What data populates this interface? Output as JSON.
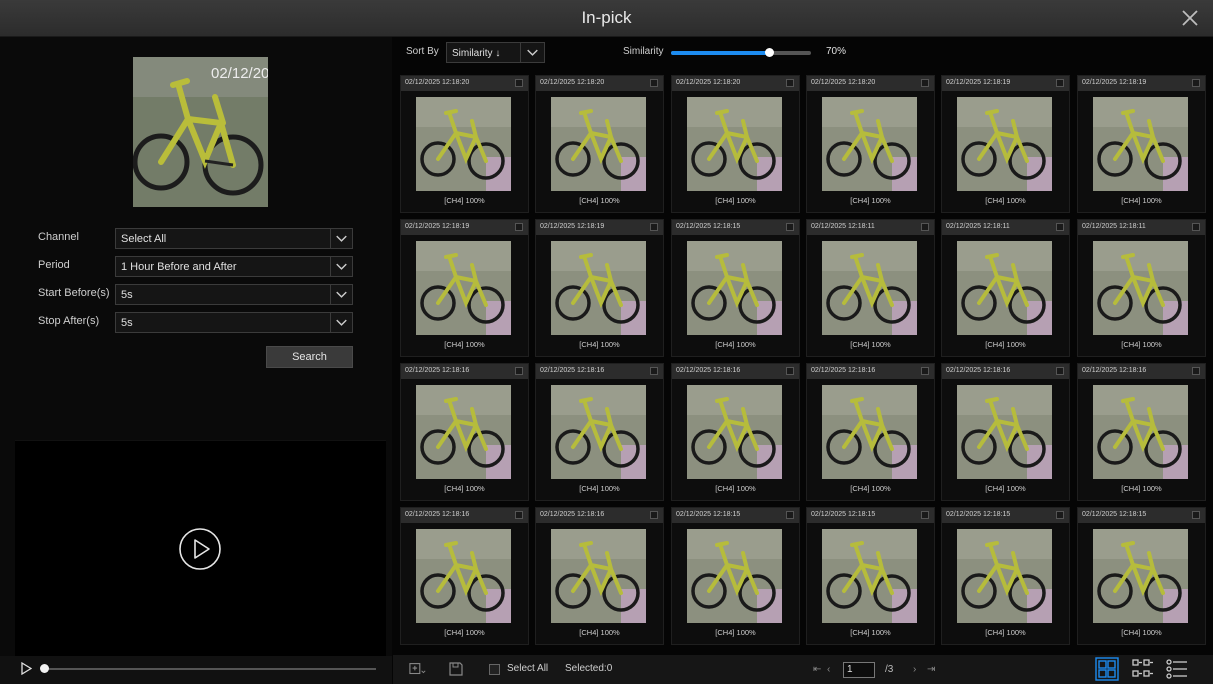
{
  "window": {
    "title": "In-pick"
  },
  "query": {
    "timestamp_overlay": "02/12/20"
  },
  "form": {
    "channel": {
      "label": "Channel",
      "value": "Select All"
    },
    "period": {
      "label": "Period",
      "value": "1 Hour Before and After"
    },
    "start_before": {
      "label": "Start Before(s)",
      "value": "5s"
    },
    "stop_after": {
      "label": "Stop After(s)",
      "value": "5s"
    },
    "search_label": "Search"
  },
  "player": {
    "progress": 0
  },
  "toolbar": {
    "sort_label": "Sort By",
    "sort_value": "Similarity ↓",
    "similarity_label": "Similarity",
    "similarity_value": "70%",
    "similarity_fraction": 0.7
  },
  "results": [
    {
      "time": "02/12/2025 12:18:20",
      "caption": "[CH4] 100%"
    },
    {
      "time": "02/12/2025 12:18:20",
      "caption": "[CH4] 100%"
    },
    {
      "time": "02/12/2025 12:18:20",
      "caption": "[CH4] 100%"
    },
    {
      "time": "02/12/2025 12:18:20",
      "caption": "[CH4] 100%"
    },
    {
      "time": "02/12/2025 12:18:19",
      "caption": "[CH4] 100%"
    },
    {
      "time": "02/12/2025 12:18:19",
      "caption": "[CH4] 100%"
    },
    {
      "time": "02/12/2025 12:18:19",
      "caption": "[CH4] 100%"
    },
    {
      "time": "02/12/2025 12:18:19",
      "caption": "[CH4] 100%"
    },
    {
      "time": "02/12/2025 12:18:15",
      "caption": "[CH4] 100%"
    },
    {
      "time": "02/12/2025 12:18:11",
      "caption": "[CH4] 100%"
    },
    {
      "time": "02/12/2025 12:18:11",
      "caption": "[CH4] 100%"
    },
    {
      "time": "02/12/2025 12:18:11",
      "caption": "[CH4] 100%"
    },
    {
      "time": "02/12/2025 12:18:16",
      "caption": "[CH4] 100%"
    },
    {
      "time": "02/12/2025 12:18:16",
      "caption": "[CH4] 100%"
    },
    {
      "time": "02/12/2025 12:18:16",
      "caption": "[CH4] 100%"
    },
    {
      "time": "02/12/2025 12:18:16",
      "caption": "[CH4] 100%"
    },
    {
      "time": "02/12/2025 12:18:16",
      "caption": "[CH4] 100%"
    },
    {
      "time": "02/12/2025 12:18:16",
      "caption": "[CH4] 100%"
    },
    {
      "time": "02/12/2025 12:18:16",
      "caption": "[CH4] 100%"
    },
    {
      "time": "02/12/2025 12:18:16",
      "caption": "[CH4] 100%"
    },
    {
      "time": "02/12/2025 12:18:15",
      "caption": "[CH4] 100%"
    },
    {
      "time": "02/12/2025 12:18:15",
      "caption": "[CH4] 100%"
    },
    {
      "time": "02/12/2025 12:18:15",
      "caption": "[CH4] 100%"
    },
    {
      "time": "02/12/2025 12:18:15",
      "caption": "[CH4] 100%"
    }
  ],
  "bottom": {
    "select_all_label": "Select All",
    "selected_label": "Selected:0",
    "page_current": "1",
    "page_total": "/3"
  },
  "colors": {
    "accent": "#1d8cf0",
    "background": "#050505",
    "card_header": "#2c2c2c"
  },
  "icons": [
    "close-icon",
    "chevron-down-icon",
    "play-icon",
    "export-icon",
    "save-icon",
    "grid-view-icon",
    "thumb-list-view-icon",
    "list-view-icon"
  ]
}
